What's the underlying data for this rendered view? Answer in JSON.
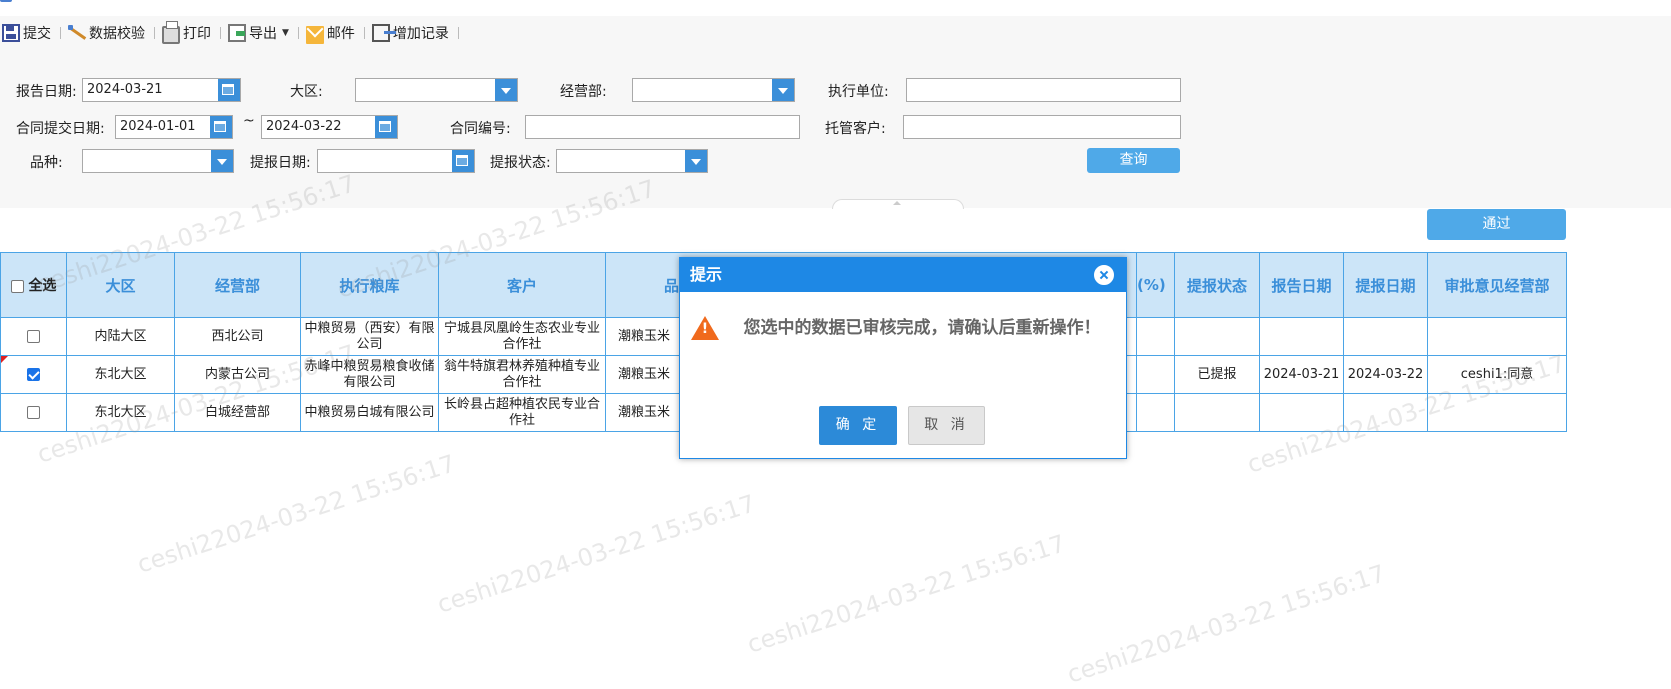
{
  "toolbar": {
    "submit": "提交",
    "validate": "数据校验",
    "print": "打印",
    "export": "导出",
    "mail": "邮件",
    "add_record": "增加记录"
  },
  "filters": {
    "report_date_label": "报告日期:",
    "report_date_value": "2024-03-21",
    "region_label": "大区:",
    "region_value": "",
    "dept_label": "经营部:",
    "dept_value": "",
    "exec_unit_label": "执行单位:",
    "exec_unit_value": "",
    "contract_date_label": "合同提交日期:",
    "contract_date_from": "2024-01-01",
    "range_sep": "~",
    "contract_date_to": "2024-03-22",
    "contract_no_label": "合同编号:",
    "contract_no_value": "",
    "custodian_label": "托管客户:",
    "custodian_value": "",
    "variety_label": "品种:",
    "variety_value": "",
    "pickup_date_label": "提报日期:",
    "pickup_date_value": "",
    "pickup_status_label": "提报状态:",
    "pickup_status_value": "",
    "query_button": "查询"
  },
  "pass_button": "通过",
  "table": {
    "select_all": "全选",
    "headers": {
      "region": "大区",
      "dept": "经营部",
      "warehouse": "执行粮库",
      "customer": "客户",
      "variety": "品",
      "pct": "(%)",
      "status": "提报状态",
      "report_date": "报告日期",
      "pickup_date": "提报日期",
      "opinion": "审批意见经营部"
    },
    "rows": [
      {
        "checked": false,
        "region": "内陆大区",
        "dept": "西北公司",
        "warehouse": "中粮贸易（西安）有限公司",
        "customer": "宁城县凤凰岭生态农业专业合作社",
        "variety": "潮粮玉米",
        "status": "",
        "report_date": "",
        "pickup_date": "",
        "opinion": ""
      },
      {
        "checked": true,
        "region": "东北大区",
        "dept": "内蒙古公司",
        "warehouse": "赤峰中粮贸易粮食收储有限公司",
        "customer": "翁牛特旗君林养殖种植专业合作社",
        "variety": "潮粮玉米",
        "status": "已提报",
        "report_date": "2024-03-21",
        "pickup_date": "2024-03-22",
        "opinion": "ceshi1:同意"
      },
      {
        "checked": false,
        "region": "东北大区",
        "dept": "白城经营部",
        "warehouse": "中粮贸易白城有限公司",
        "customer": "长岭县占超种植农民专业合作社",
        "variety": "潮粮玉米",
        "status": "",
        "report_date": "",
        "pickup_date": "",
        "opinion": ""
      }
    ]
  },
  "dialog": {
    "title": "提示",
    "message": "您选中的数据已审核完成，请确认后重新操作！",
    "ok": "确 定",
    "cancel": "取 消"
  },
  "watermark": "ceshi22024-03-22 15:56:17"
}
